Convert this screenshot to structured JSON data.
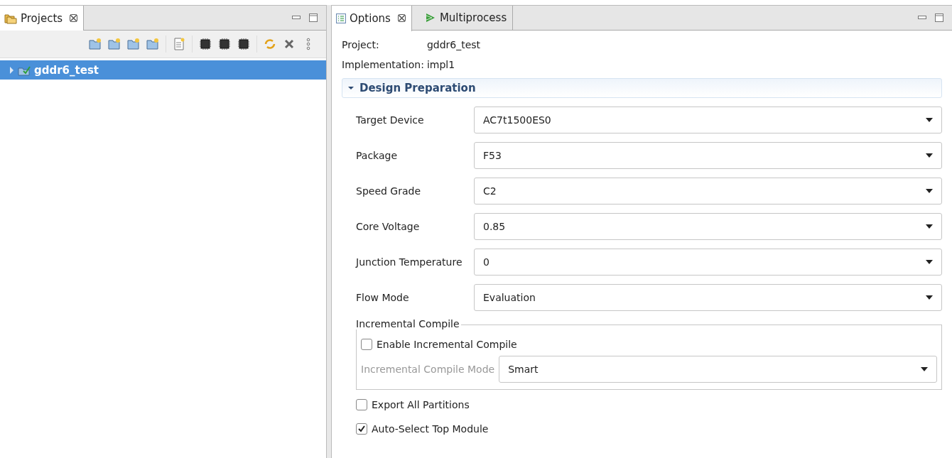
{
  "projects_panel": {
    "tab": {
      "label": "Projects",
      "selected": true
    },
    "tree": [
      {
        "label": "gddr6_test",
        "selected": true,
        "expanded": false
      }
    ]
  },
  "options_panel": {
    "tabs": [
      {
        "label": "Options",
        "selected": true
      },
      {
        "label": "Multiprocess",
        "selected": false
      }
    ],
    "info": [
      {
        "label": "Project:",
        "value": "gddr6_test"
      },
      {
        "label": "Implementation:",
        "value": "impl1"
      }
    ],
    "section": {
      "title": "Design Preparation",
      "expanded": true
    },
    "fields": [
      {
        "label": "Target Device",
        "value": "AC7t1500ES0"
      },
      {
        "label": "Package",
        "value": "F53"
      },
      {
        "label": "Speed Grade",
        "value": "C2"
      },
      {
        "label": "Core Voltage",
        "value": "0.85"
      },
      {
        "label": "Junction Temperature",
        "value": "0"
      },
      {
        "label": "Flow Mode",
        "value": "Evaluation"
      }
    ],
    "incremental_group": {
      "title": "Incremental Compile",
      "enable": {
        "label": "Enable Incremental Compile",
        "checked": false
      },
      "mode": {
        "label": "Incremental Compile Mode",
        "value": "Smart",
        "disabled": true
      }
    },
    "checkboxes": [
      {
        "label": "Export All Partitions",
        "checked": false
      },
      {
        "label": "Auto-Select Top Module",
        "checked": true
      }
    ]
  }
}
